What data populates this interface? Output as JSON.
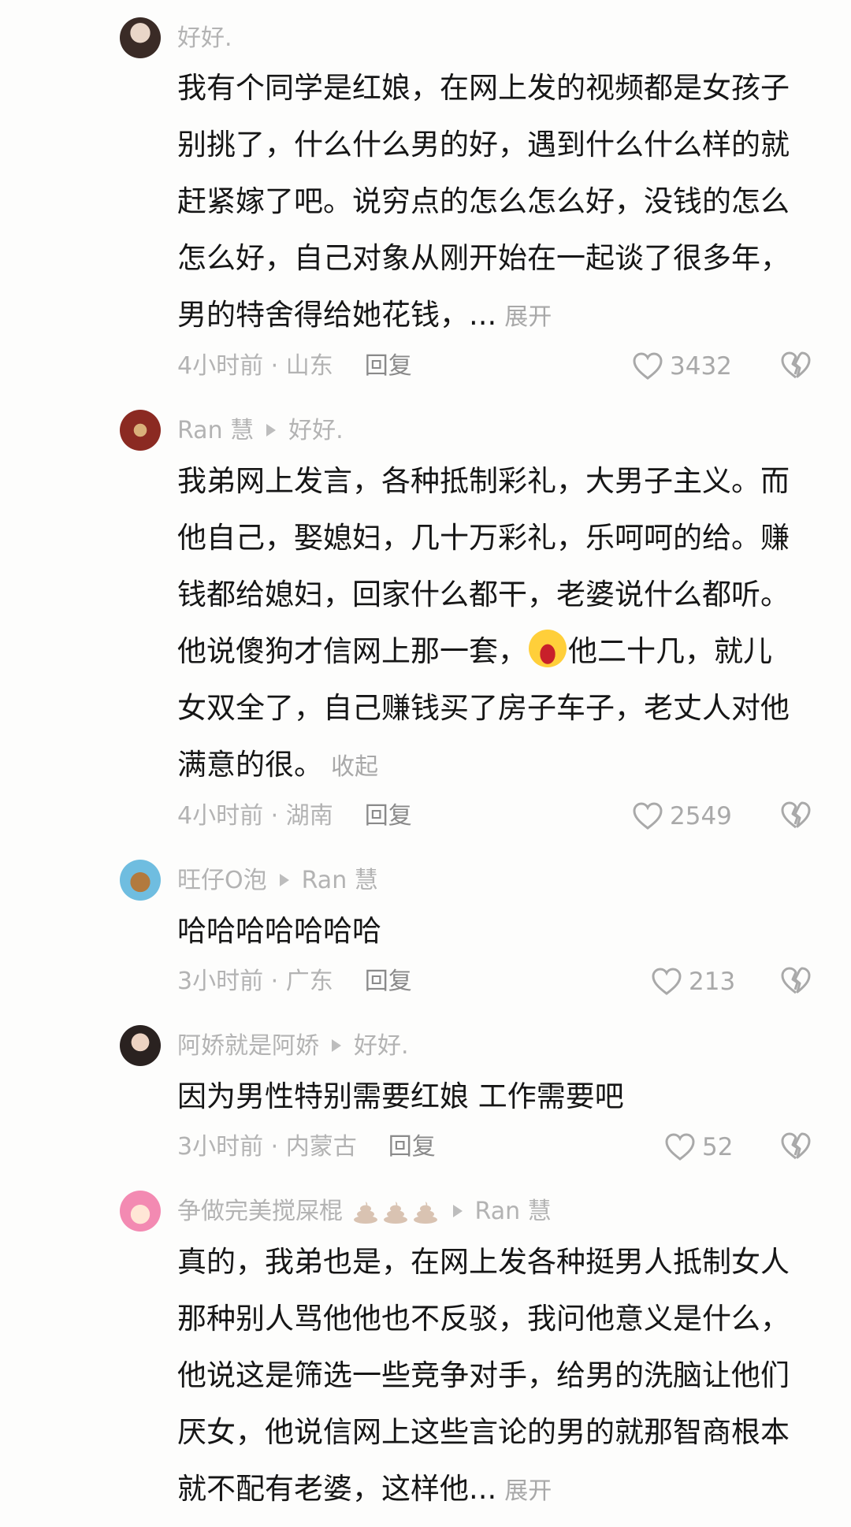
{
  "comments": [
    {
      "name": "好好.",
      "lines": [
        "我有个同学是红娘，在网上发的视频都是女孩子",
        "别挑了，什么什么男的好，遇到什么什么样的就",
        "赶紧嫁了吧。说穷点的怎么怎么好，没钱的怎么",
        "怎么好，自己对象从刚开始在一起谈了很多年，",
        "男的特舍得给她花钱，..."
      ],
      "more": "展开",
      "meta": "4小时前 · 山东",
      "reply": "回复",
      "likes": "3432"
    },
    {
      "name": "Ran 慧",
      "reply_to": "好好.",
      "lines": [
        "我弟网上发言，各种抵制彩礼，大男子主义。而",
        "他自己，娶媳妇，几十万彩礼，乐呵呵的给。赚",
        "钱都给媳妇，回家什么都干，老婆说什么都听。",
        "他说傻狗才信网上那一套，",
        "他二十几，就儿",
        "女双全了，自己赚钱买了房子车子，老丈人对他",
        "满意的很。"
      ],
      "more": "收起",
      "meta": "4小时前 · 湖南",
      "reply": "回复",
      "likes": "2549"
    },
    {
      "name": "旺仔O泡",
      "reply_to": "Ran 慧",
      "lines": [
        "哈哈哈哈哈哈哈"
      ],
      "meta": "3小时前 · 广东",
      "reply": "回复",
      "likes": "213"
    },
    {
      "name": "阿娇就是阿娇",
      "reply_to": "好好.",
      "lines": [
        "因为男性特别需要红娘 工作需要吧"
      ],
      "meta": "3小时前 · 内蒙古",
      "reply": "回复",
      "likes": "52"
    },
    {
      "name": "争做完美搅屎棍",
      "reply_to": "Ran 慧",
      "lines": [
        "真的，我弟也是，在网上发各种挺男人抵制女人",
        "那种别人骂他他也不反驳，我问他意义是什么，",
        "他说这是筛选一些竞争对手，给男的洗脑让他们",
        "厌女，他说信网上这些言论的男的就那智商根本",
        "就不配有老婆，这样他..."
      ],
      "more": "展开"
    }
  ],
  "colors": {
    "text": "#161616",
    "meta": "#b3b3b3",
    "link": "#a8a8a8"
  },
  "icons": [
    "heart-outline-icon",
    "broken-heart-icon",
    "play-triangle-icon",
    "laughing-emoji-icon",
    "poop-emoji-icon"
  ]
}
